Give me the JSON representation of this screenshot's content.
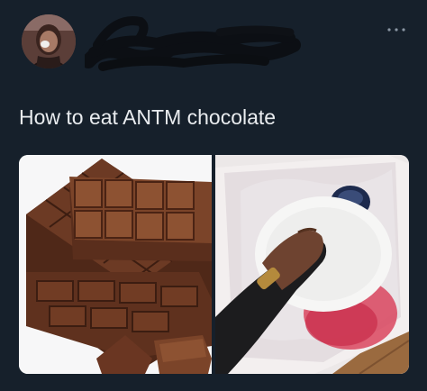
{
  "tweet": {
    "text": "How to eat ANTM chocolate",
    "author": {
      "avatar_icon": "profile-photo",
      "name_visibility": "scribbled-out"
    },
    "more_icon": "more-horizontal-icon",
    "media": [
      {
        "name": "chocolate-bar-image",
        "description_icon": "chocolate-bar"
      },
      {
        "name": "hand-holding-plate-image",
        "description_icon": "hand-with-plate"
      }
    ]
  },
  "colors": {
    "background": "#16202b",
    "text": "#e9ecef",
    "chocolate": "#6b3a24",
    "scribble": "#0c0f14"
  }
}
